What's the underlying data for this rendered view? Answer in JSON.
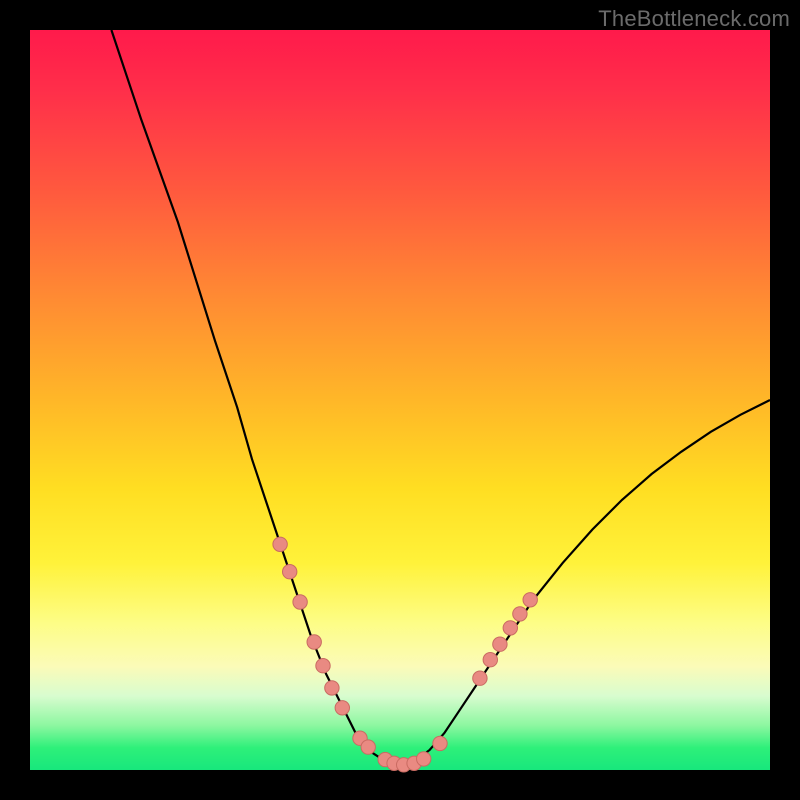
{
  "watermark": "TheBottleneck.com",
  "colors": {
    "background": "#000000",
    "curve": "#000000",
    "marker_fill": "#e98a82",
    "marker_stroke": "#c96b62"
  },
  "chart_data": {
    "type": "line",
    "title": "",
    "xlabel": "",
    "ylabel": "",
    "xlim": [
      0,
      100
    ],
    "ylim": [
      0,
      100
    ],
    "note": "No axis tick labels are visible in the image; values below are estimated from pixel position on a 0-100 normalized scale where y=0 is the bottom (green) and y=100 is the top (red).",
    "series": [
      {
        "name": "curve",
        "x": [
          11,
          15,
          20,
          25,
          28,
          30,
          32,
          34,
          36,
          38,
          40,
          42,
          44,
          46,
          48,
          50,
          52,
          54,
          56,
          58,
          60,
          64,
          68,
          72,
          76,
          80,
          84,
          88,
          92,
          96,
          100
        ],
        "y": [
          100,
          88,
          74,
          58,
          49,
          42,
          36,
          30,
          24,
          18,
          13,
          9,
          5,
          2.5,
          1.2,
          0.6,
          1.2,
          2.7,
          5,
          8,
          11,
          17,
          23,
          28,
          32.5,
          36.5,
          40,
          43,
          45.7,
          48,
          50
        ]
      }
    ],
    "markers": {
      "name": "highlighted-points",
      "points": [
        {
          "x": 33.8,
          "y": 30.5
        },
        {
          "x": 35.1,
          "y": 26.8
        },
        {
          "x": 36.5,
          "y": 22.7
        },
        {
          "x": 38.4,
          "y": 17.3
        },
        {
          "x": 39.6,
          "y": 14.1
        },
        {
          "x": 40.8,
          "y": 11.1
        },
        {
          "x": 42.2,
          "y": 8.4
        },
        {
          "x": 44.6,
          "y": 4.3
        },
        {
          "x": 45.7,
          "y": 3.1
        },
        {
          "x": 48.0,
          "y": 1.4
        },
        {
          "x": 49.2,
          "y": 0.9
        },
        {
          "x": 50.5,
          "y": 0.7
        },
        {
          "x": 51.9,
          "y": 0.9
        },
        {
          "x": 53.2,
          "y": 1.5
        },
        {
          "x": 55.4,
          "y": 3.6
        },
        {
          "x": 60.8,
          "y": 12.4
        },
        {
          "x": 62.2,
          "y": 14.9
        },
        {
          "x": 63.5,
          "y": 17.0
        },
        {
          "x": 64.9,
          "y": 19.2
        },
        {
          "x": 66.2,
          "y": 21.1
        },
        {
          "x": 67.6,
          "y": 23.0
        }
      ]
    }
  }
}
